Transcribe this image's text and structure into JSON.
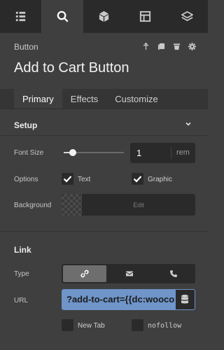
{
  "toolbar": {
    "items": [
      {
        "icon": "list-icon",
        "active": false
      },
      {
        "icon": "search-icon",
        "active": true
      },
      {
        "icon": "cube-icon",
        "active": false
      },
      {
        "icon": "layout-icon",
        "active": false
      },
      {
        "icon": "layers-icon",
        "active": false
      }
    ]
  },
  "header": {
    "element_type": "Button",
    "title": "Add to Cart Button",
    "actions": [
      "move-icon",
      "copy-icon",
      "trash-icon",
      "gear-icon"
    ]
  },
  "tabs": [
    {
      "label": "Primary",
      "active": true
    },
    {
      "label": "Effects",
      "active": false
    },
    {
      "label": "Customize",
      "active": false
    }
  ],
  "setup": {
    "title": "Setup",
    "font_size": {
      "label": "Font Size",
      "value": "1",
      "unit": "rem"
    },
    "options": {
      "label": "Options",
      "text": {
        "label": "Text",
        "checked": true
      },
      "graphic": {
        "label": "Graphic",
        "checked": true
      }
    },
    "background": {
      "label": "Background",
      "edit_label": "Edit"
    }
  },
  "link": {
    "title": "Link",
    "type": {
      "label": "Type",
      "options": [
        "link-icon",
        "mail-icon",
        "phone-icon"
      ],
      "selected": 0
    },
    "url": {
      "label": "URL",
      "value": "?add-to-cart={{dc:woocomm"
    },
    "new_tab": {
      "label": "New Tab",
      "checked": false
    },
    "nofollow": {
      "label": "nofollow",
      "checked": false
    }
  },
  "colors": {
    "accent": "#6f95c9",
    "panel_bg": "#3f3f3f",
    "field_bg": "#2a2a2a"
  }
}
